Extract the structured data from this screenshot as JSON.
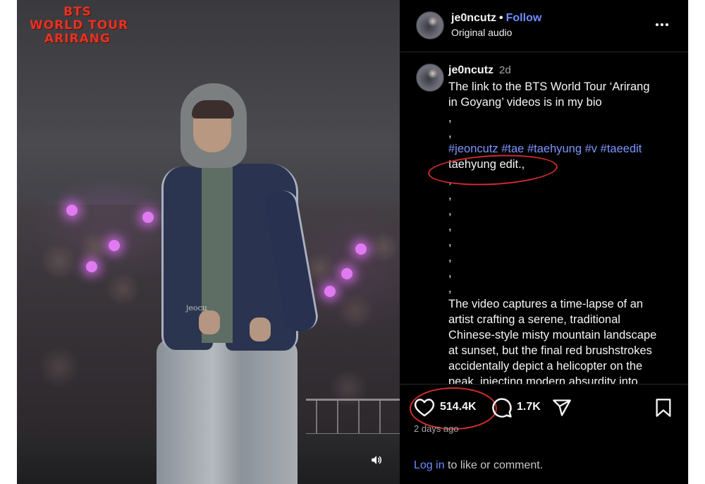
{
  "video": {
    "tour_logo": [
      "BTS",
      "WORLD TOUR",
      "ARIRANG"
    ],
    "watermark": "jeocu",
    "mute_icon": "speaker-icon"
  },
  "header": {
    "username": "je0ncutz",
    "separator": "•",
    "follow_label": "Follow",
    "audio_label": "Original audio",
    "more_icon": "more-options-icon"
  },
  "caption": {
    "username": "je0ncutz",
    "time": "2d",
    "lines": [
      "The link to the BTS World Tour ‘Arirang",
      "in Goyang’ videos is in my bio",
      ",",
      ","
    ],
    "hashtags": [
      "#jeoncutz",
      "#tae",
      "#taehyung",
      "#v",
      "#taeedit"
    ],
    "edit_line": "taehyung edit.,",
    "comma_lines": [
      ",",
      ",",
      ",",
      ",",
      ",",
      ",",
      ",",
      ","
    ],
    "description_lines": [
      "The video captures a time-lapse of an",
      "artist crafting a serene, traditional",
      "Chinese-style misty mountain landscape",
      "at sunset, but the final red brushstrokes",
      "accidentally depict a helicopter on the",
      "peak, injecting modern absurdity into"
    ]
  },
  "actions": {
    "like_icon": "heart-icon",
    "like_count": "514.4K",
    "comment_icon": "comment-icon",
    "comment_count": "1.7K",
    "share_icon": "send-icon",
    "save_icon": "bookmark-icon",
    "post_age": "2 days ago",
    "login_link": "Log in",
    "login_suffix": " to like or comment."
  },
  "colors": {
    "background": "#000000",
    "link_blue": "#6f8cff",
    "hashtag_blue": "#7f95ff",
    "annotation_red": "#d22c2c",
    "logo_red": "#e23424"
  }
}
